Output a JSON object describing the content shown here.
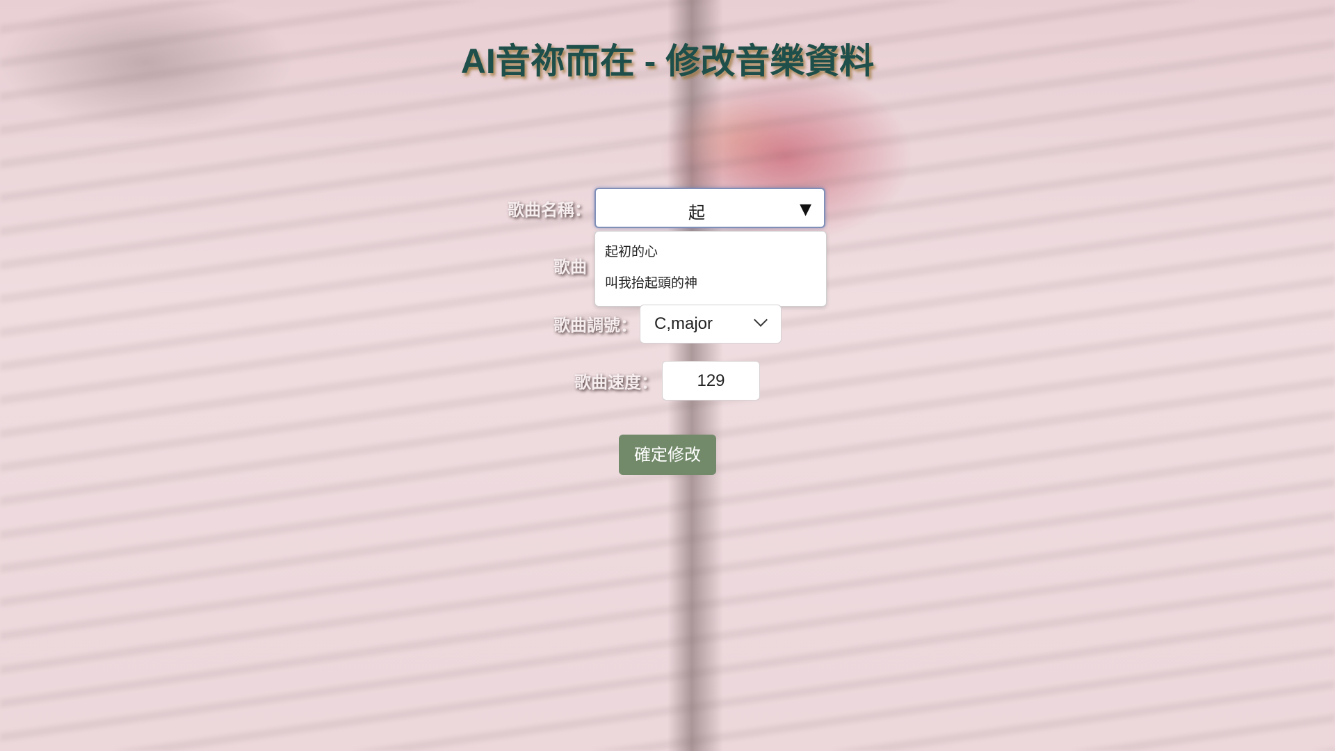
{
  "page": {
    "title": "AI音祢而在 - 修改音樂資料"
  },
  "form": {
    "song_name": {
      "label": "歌曲名稱：",
      "value": "起",
      "suggestions": [
        "起初的心",
        "叫我抬起頭的神"
      ]
    },
    "song_type": {
      "label_visible": "歌曲"
    },
    "song_key": {
      "label": "歌曲調號：",
      "value": "C,major"
    },
    "song_tempo": {
      "label": "歌曲速度：",
      "value": "129"
    },
    "submit_label": "確定修改"
  },
  "colors": {
    "title": "#1e4f4a",
    "title_shadow": "#966e28",
    "submit_bg": "#728a6a",
    "focus_border": "#7f8fb8"
  },
  "icons": {
    "combo_toggle": "triangle-down-icon",
    "select_toggle": "chevron-down-icon"
  }
}
